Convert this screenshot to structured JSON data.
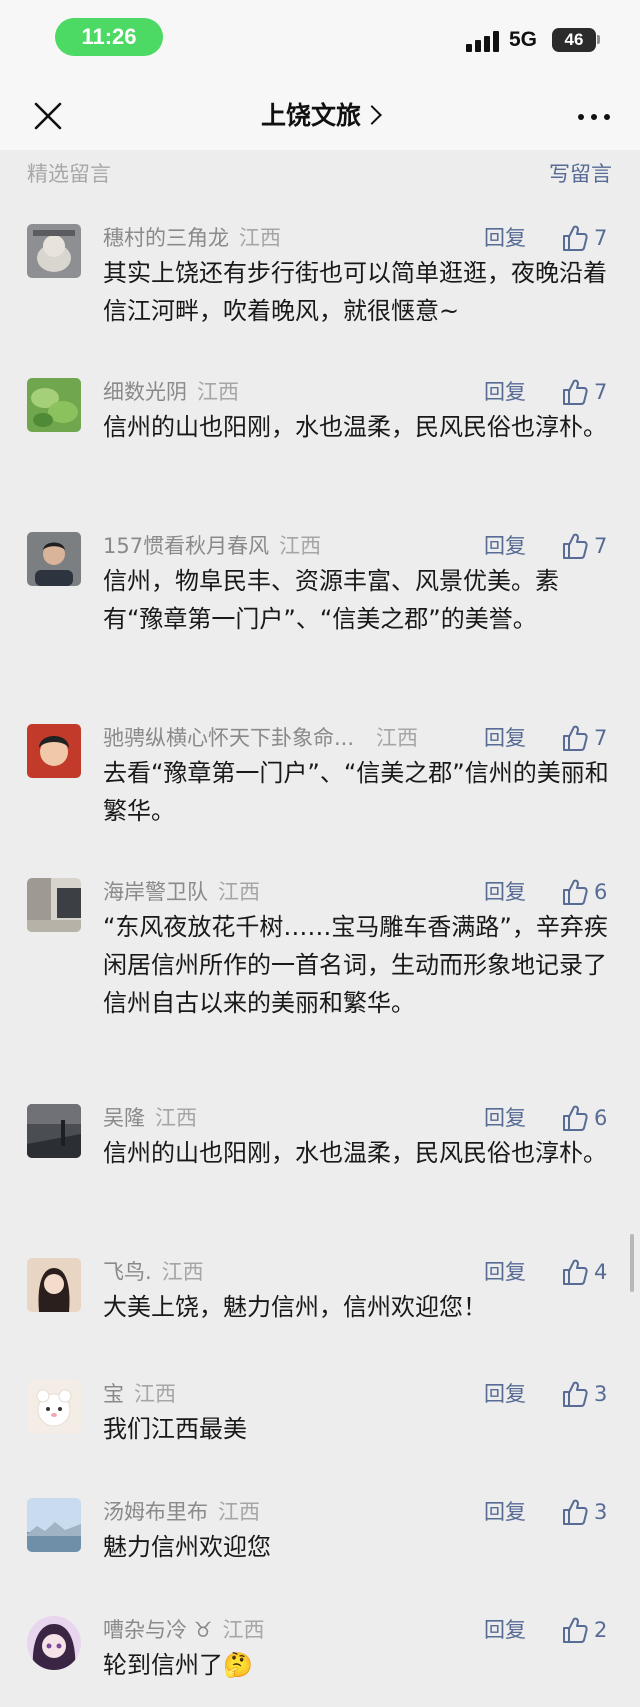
{
  "status_bar": {
    "time": "11:26",
    "network": "5G",
    "battery": "46"
  },
  "nav": {
    "title": "上饶文旅"
  },
  "section": {
    "title": "精选留言",
    "action": "写留言"
  },
  "reply_label": "回复",
  "comments": [
    {
      "name": "穗村的三角龙",
      "region": "江西",
      "likes": "7",
      "text": "其实上饶还有步行街也可以简单逛逛，夜晚沿着信江河畔，吹着晚风，就很惬意~"
    },
    {
      "name": "细数光阴",
      "region": "江西",
      "likes": "7",
      "text": "信州的山也阳刚，水也温柔，民风民俗也淳朴。"
    },
    {
      "name": "157惯看秋月春风",
      "region": "江西",
      "likes": "7",
      "text": "信州，物阜民丰、资源丰富、风景优美。素有“豫章第一门户”、“信美之郡”的美誉。"
    },
    {
      "name": "驰骋纵横心怀天下卦象命...",
      "region": "江西",
      "likes": "7",
      "text": "去看“豫章第一门户”、“信美之郡”信州的美丽和繁华。"
    },
    {
      "name": "海岸警卫队",
      "region": "江西",
      "likes": "6",
      "text": "“东风夜放花千树……宝马雕车香满路”，辛弃疾闲居信州所作的一首名词，生动而形象地记录了信州自古以来的美丽和繁华。"
    },
    {
      "name": "吴隆",
      "region": "江西",
      "likes": "6",
      "text": "信州的山也阳刚，水也温柔，民风民俗也淳朴。"
    },
    {
      "name": "飞鸟.",
      "region": "江西",
      "likes": "4",
      "text": "大美上饶，魅力信州，信州欢迎您！"
    },
    {
      "name": "宝",
      "region": "江西",
      "likes": "3",
      "text": "我们江西最美"
    },
    {
      "name": "汤姆布里布",
      "region": "江西",
      "likes": "3",
      "text": "魅力信州欢迎您"
    },
    {
      "name": "嘈杂与冷 ♉",
      "region": "江西",
      "likes": "2",
      "text": "轮到信州了🤔"
    }
  ]
}
